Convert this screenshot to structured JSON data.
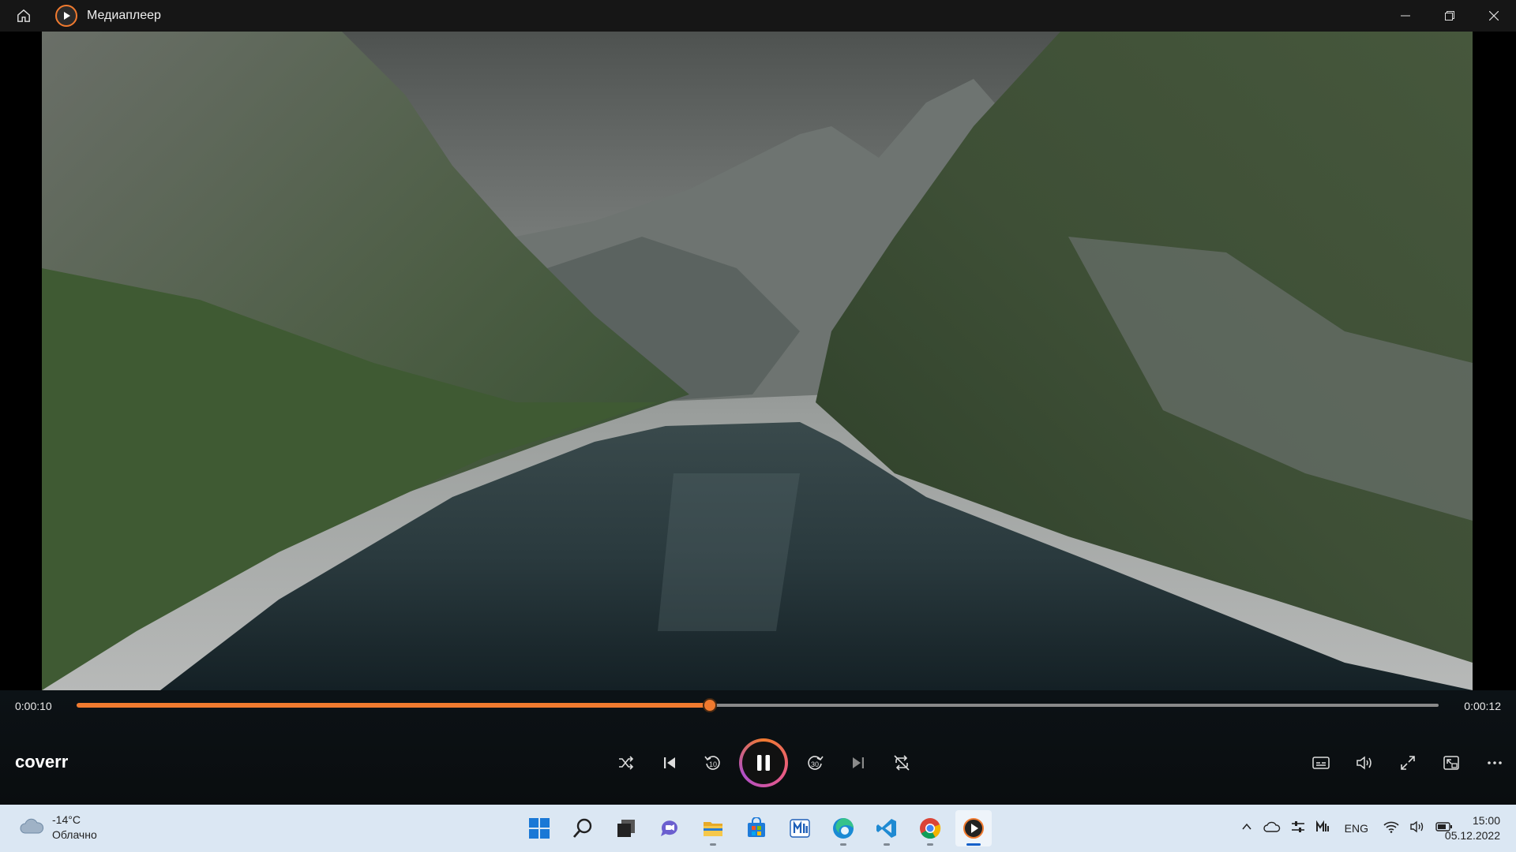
{
  "window": {
    "title": "Медиаплеер",
    "home_icon": "home-icon",
    "app_icon": "media-player-icon",
    "controls": [
      "minimize-icon",
      "restore-icon",
      "close-icon"
    ]
  },
  "player": {
    "current_time": "0:00:10",
    "total_time": "0:00:12",
    "progress_fraction": 0.465,
    "media_title": "coverr",
    "accent_color": "#f07a2f",
    "controls": [
      "shuffle-icon",
      "previous-icon",
      "rewind-10-icon",
      "pause-icon",
      "forward-30-icon",
      "next-icon",
      "repeat-off-icon"
    ],
    "right_controls": [
      "subtitles-icon",
      "volume-icon",
      "fullscreen-icon",
      "mini-player-icon",
      "more-icon"
    ]
  },
  "taskbar": {
    "weather": {
      "temp": "-14°C",
      "condition": "Облачно",
      "icon": "cloud-icon"
    },
    "apps": [
      "windows-start-icon",
      "search-icon",
      "task-view-icon",
      "chat-icon",
      "file-explorer-icon",
      "microsoft-store-icon",
      "app-icon",
      "edge-icon",
      "vscode-icon",
      "chrome-icon",
      "media-player-icon"
    ],
    "tray": {
      "language": "ENG",
      "icons": [
        "chevron-up-icon",
        "onedrive-icon",
        "settings-sliders-icon",
        "app-tray-icon",
        "wifi-icon",
        "speaker-icon",
        "battery-icon"
      ]
    },
    "time": "15:00",
    "date": "05.12.2022"
  }
}
